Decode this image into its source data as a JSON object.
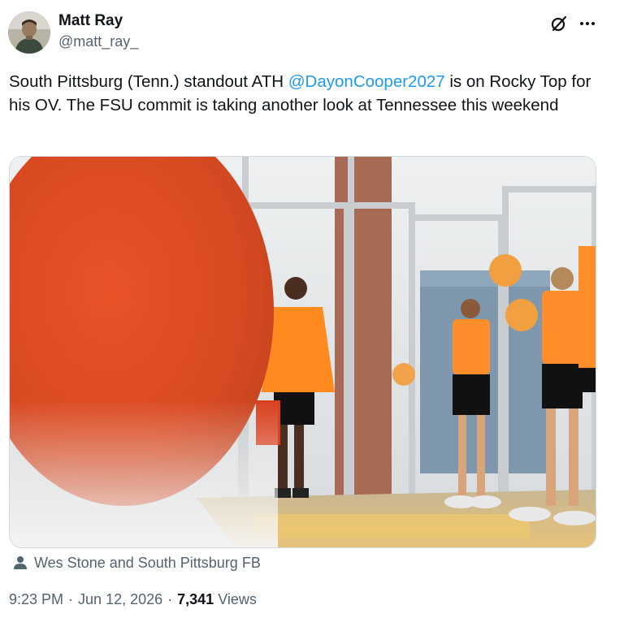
{
  "author": {
    "name": "Matt Ray",
    "handle": "@matt_ray_"
  },
  "icons": {
    "grok": "grok-slash-circle-icon",
    "more": "more-horizontal-icon",
    "credit": "person-icon"
  },
  "tweet": {
    "text_1": "South Pittsburg (Tenn.)  standout ATH ",
    "mention": "@DayonCooper2027",
    "text_2": " is on Rocky Top for his OV. The FSU commit is taking another look at Tennessee this weekend"
  },
  "media": {
    "credit": "Wes Stone and South Pittsburg FB"
  },
  "meta": {
    "time": "9:23 PM",
    "date": "Jun 12, 2026",
    "views_count": "7,341",
    "views_label": "Views",
    "separator": "·"
  },
  "colors": {
    "accent": "#1d9bf0",
    "secondary_text": "#536471",
    "primary_text": "#0f1419",
    "tennessee_orange": "#ff8200"
  }
}
